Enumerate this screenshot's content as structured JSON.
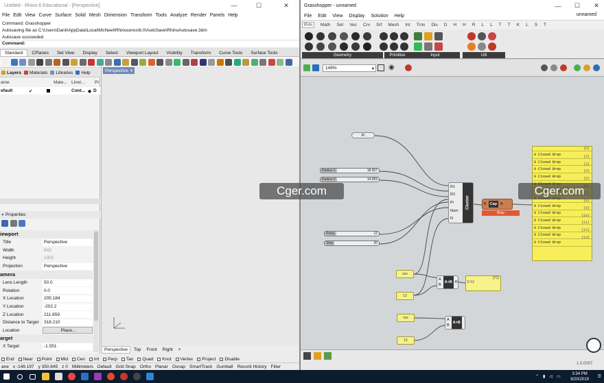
{
  "rhino": {
    "title": "Untitled - Rhino 6 Educational - [Perspective]",
    "menu": [
      "File",
      "Edit",
      "View",
      "Curve",
      "Surface",
      "Solid",
      "Mesh",
      "Dimension",
      "Transform",
      "Tools",
      "Analyze",
      "Render",
      "Panels",
      "Help"
    ],
    "command_history": [
      "Command: Grasshopper",
      "Autosaving file as C:\\Users\\Danil\\AppData\\Local\\McNeel\\Rhinoceros\\6.0\\AutoSave\\RhinoAutosave.3dm",
      "Autosave succeeded"
    ],
    "command_prompt": "Command:",
    "tabs": [
      "Standard",
      "CPlanes",
      "Set View",
      "Display",
      "Select",
      "Viewport Layout",
      "Visibility",
      "Transform",
      "Curve Tools",
      "Surface Tools"
    ],
    "panel_tabs": [
      "Layers",
      "Materials",
      "Libraries",
      "Help"
    ],
    "layer_headers": [
      "ame",
      "Mate...",
      "Linet...",
      "Pr"
    ],
    "layer_row": {
      "name": "efault",
      "linetype": "Cont...",
      "print": "D"
    },
    "properties_title": "Properties",
    "properties": {
      "viewport_section": "iewport",
      "rows1": [
        {
          "k": "Title",
          "v": "Perspective"
        },
        {
          "k": "Width",
          "v": "942"
        },
        {
          "k": "Height",
          "v": "1302"
        },
        {
          "k": "Projection",
          "v": "Perspective"
        }
      ],
      "camera_section": "amera",
      "rows2": [
        {
          "k": "Lens Length",
          "v": "50.0"
        },
        {
          "k": "Rotation",
          "v": "0.0"
        },
        {
          "k": "X Location",
          "v": "205.184"
        },
        {
          "k": "Y Location",
          "v": "-202.2"
        },
        {
          "k": "Z Location",
          "v": "211.659"
        },
        {
          "k": "Distance to Target",
          "v": "318.210"
        },
        {
          "k": "Location",
          "v": "Place..."
        }
      ],
      "target_section": "arget",
      "rows3": [
        {
          "k": "X Target",
          "v": "-1.551"
        }
      ]
    },
    "viewport_label": "Perspective",
    "viewport_tabs": [
      "Perspective",
      "Top",
      "Front",
      "Right"
    ],
    "osnaps": [
      "End",
      "Near",
      "Point",
      "Mid",
      "Cen",
      "Int",
      "Perp",
      "Tan",
      "Quad",
      "Knot",
      "Vertex",
      "Project",
      "Disable"
    ],
    "status": [
      "ane",
      "x -149.197",
      "y 350.845",
      "z 0",
      "Millimeters",
      "Default",
      "Grid Snap",
      "Ortho",
      "Planar",
      "Osnap",
      "SmartTrack",
      "Gumball",
      "Record History",
      "Filter"
    ]
  },
  "gh": {
    "title": "Grasshopper - unnamed",
    "menu": [
      "File",
      "Edit",
      "View",
      "Display",
      "Solution",
      "Help"
    ],
    "doc_name": "unnamed",
    "tabs": [
      "Prm",
      "Math",
      "Set",
      "Vec",
      "Crv",
      "Srf",
      "Mesh",
      "Int",
      "Trns",
      "Dis",
      "D",
      "H",
      "H",
      "R",
      "L",
      "L",
      "T",
      "T",
      "K",
      "L",
      "S",
      "T"
    ],
    "ribbon_sections": [
      "Geometry",
      "Primitive",
      "Input",
      "Util"
    ],
    "zoom": "149%",
    "components": {
      "pi": "Pi",
      "radius1": {
        "label": "Radius 1",
        "value": "18.357"
      },
      "radius2": {
        "label": "Radius 2",
        "value": "14.059"
      },
      "relay": {
        "label": "Relay",
        "value": "12"
      },
      "step": {
        "label": "Step",
        "value": "20"
      },
      "cluster_inputs": [
        "R1",
        "R2",
        "Pi",
        "Num",
        "N"
      ],
      "cluster_name": "Cluster",
      "cap_name": "Cap",
      "cap_error": "Brep",
      "panel_xxx1": "xxx",
      "panel_12a": "12",
      "panel_xxx2": "xxx",
      "panel_12b": "12",
      "add1_inputs": [
        "A",
        "B"
      ],
      "add1_name": "A+B",
      "add1_out": "R",
      "add2_inputs": [
        "A",
        "B"
      ],
      "add2_name": "A+B",
      "result_panel_head": "{T1}",
      "result_panel_value": "0  12"
    },
    "breps": {
      "header": "{0}",
      "items": [
        {
          "path": "{1}",
          "text": "0 Closed Brep"
        },
        {
          "path": "{2}",
          "text": "0 Closed Brep"
        },
        {
          "path": "{3}",
          "text": "0 Closed Brep"
        },
        {
          "path": "{4}",
          "text": "0 Closed Brep"
        },
        {
          "path": "{5}",
          "text": "0 Closed Brep"
        },
        {
          "path": "{6}",
          "text": "0 Closed Brep"
        },
        {
          "path": "{7}",
          "text": "0 Closed Brep"
        },
        {
          "path": "{8}",
          "text": "0 Closed Brep"
        },
        {
          "path": "{9}",
          "text": "0 Closed Brep"
        },
        {
          "path": "{10}",
          "text": "0 Closed Brep"
        },
        {
          "path": "{11}",
          "text": "0 Closed Brep"
        },
        {
          "path": "{12}",
          "text": "0 Closed Brep"
        },
        {
          "path": "{13}",
          "text": "0 Closed Brep"
        }
      ]
    },
    "version": "1.0.0007"
  },
  "watermarks": [
    "Cger.com",
    "Cger.com"
  ],
  "taskbar": {
    "time": "3:34 PM",
    "date": "8/20/2019"
  }
}
